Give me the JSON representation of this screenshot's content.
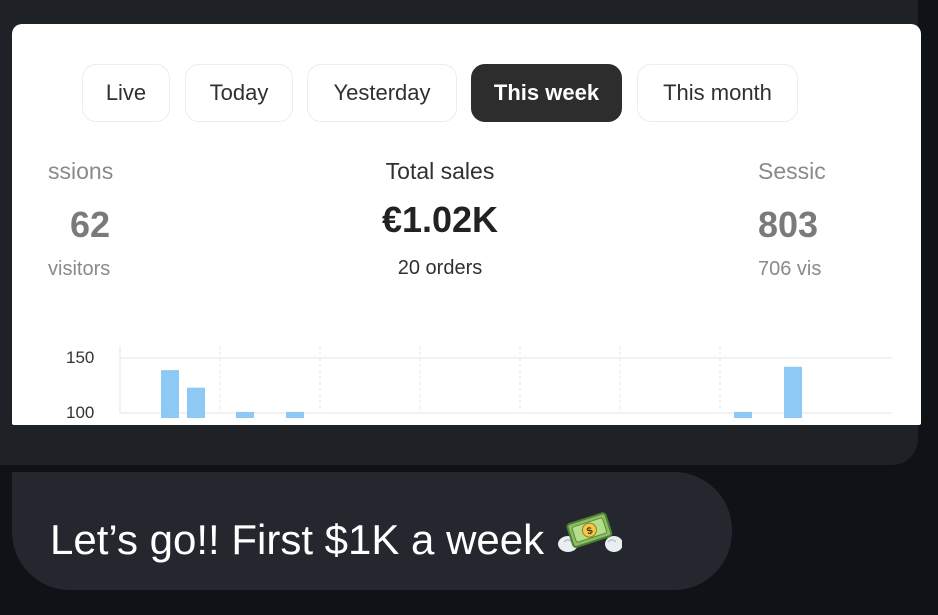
{
  "tabs": [
    {
      "label": "Live"
    },
    {
      "label": "Today"
    },
    {
      "label": "Yesterday"
    },
    {
      "label": "This week"
    },
    {
      "label": "This month"
    }
  ],
  "active_tab": "This week",
  "metrics": {
    "left": {
      "label": "ssions",
      "value": "62",
      "sub": "visitors"
    },
    "center": {
      "label": "Total sales",
      "value": "€1.02K",
      "sub": "20 orders"
    },
    "right": {
      "label": "Sessic",
      "value": "803",
      "sub": "706 vis"
    }
  },
  "chart_data": {
    "type": "bar",
    "y_ticks": [
      "150",
      "100"
    ],
    "ylim": [
      100,
      150
    ],
    "values": [
      139,
      123,
      101,
      101,
      101,
      142
    ],
    "colors": {
      "bar": "#8ec9f5",
      "grid": "#e6e6e6"
    }
  },
  "message": {
    "text": "Let’s go!! First $1K a week",
    "emoji": "money-with-wings-icon"
  }
}
